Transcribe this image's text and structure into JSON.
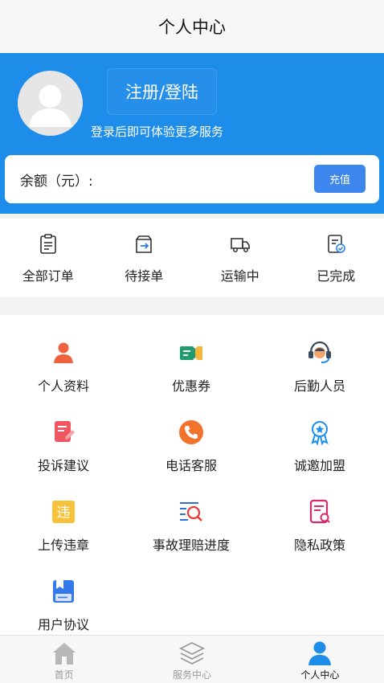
{
  "header": {
    "title": "个人中心"
  },
  "profile": {
    "login_label": "注册/登陆",
    "subtitle": "登录后即可体验更多服务",
    "balance_label": "余额（元）:",
    "recharge_label": "充值"
  },
  "orders": [
    {
      "label": "全部订单",
      "icon": "clipboard-list-icon"
    },
    {
      "label": "待接单",
      "icon": "order-arrow-icon"
    },
    {
      "label": "运输中",
      "icon": "truck-icon"
    },
    {
      "label": "已完成",
      "icon": "document-check-icon"
    }
  ],
  "services": [
    {
      "label": "个人资料",
      "icon": "person-icon",
      "color": "#f0623d"
    },
    {
      "label": "优惠券",
      "icon": "coupon-icon",
      "color": "#1f9c6e"
    },
    {
      "label": "后勤人员",
      "icon": "headset-support-icon",
      "color": "#3a4a5c"
    },
    {
      "label": "投诉建议",
      "icon": "feedback-doc-icon",
      "color": "#ef5662"
    },
    {
      "label": "电话客服",
      "icon": "phone-icon",
      "color": "#f2742c"
    },
    {
      "label": "诚邀加盟",
      "icon": "award-badge-icon",
      "color": "#1d8ff0"
    },
    {
      "label": "上传违章",
      "icon": "violation-icon",
      "color": "#f7c23a",
      "badge_text": "违"
    },
    {
      "label": "事故理赔进度",
      "icon": "search-progress-icon",
      "color": "#2f6fe0"
    },
    {
      "label": "隐私政策",
      "icon": "privacy-doc-icon",
      "color": "#d8286e"
    },
    {
      "label": "用户协议",
      "icon": "agreement-book-icon",
      "color": "#3478ea"
    }
  ],
  "tabbar": [
    {
      "label": "首页",
      "icon": "home-icon",
      "active": false
    },
    {
      "label": "服务中心",
      "icon": "layers-icon",
      "active": false
    },
    {
      "label": "个人中心",
      "icon": "user-icon",
      "active": true
    }
  ],
  "colors": {
    "primary": "#1e8ce9",
    "button": "#3d86ee",
    "tab_active": "#1e8ce9",
    "tab_inactive": "#b8b8b8"
  }
}
